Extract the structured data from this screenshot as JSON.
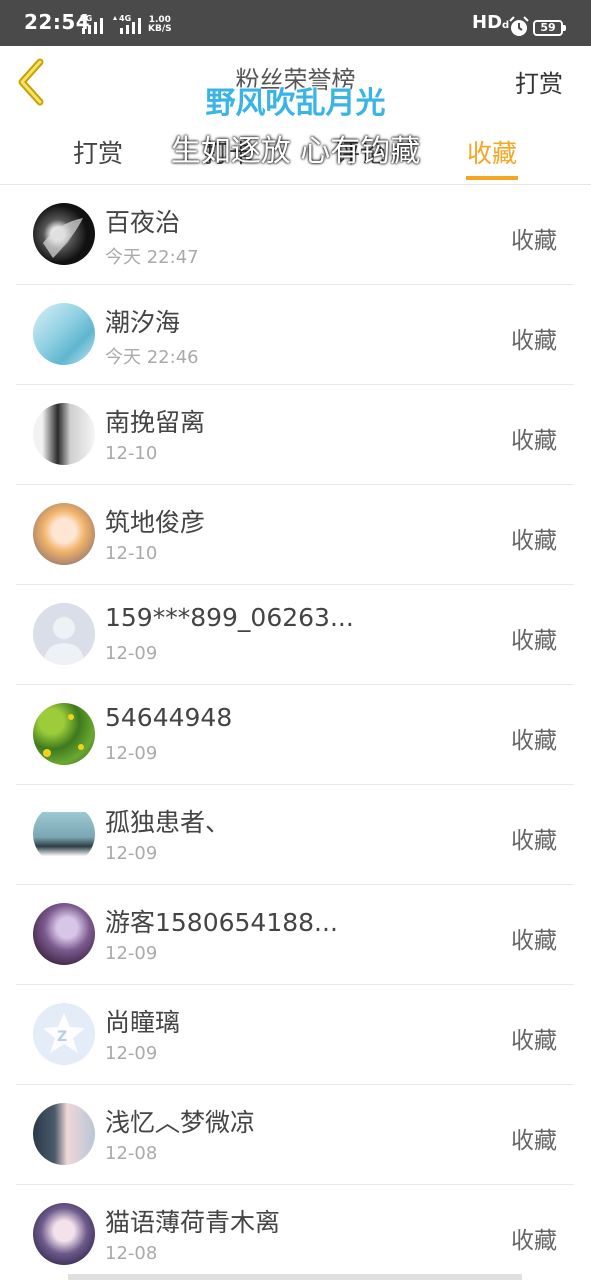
{
  "status_bar": {
    "time": "22:54",
    "net_2g": "2G",
    "net_4g": "4G",
    "speed_value": "1.00",
    "speed_unit": "KB/S",
    "hd": "HD",
    "battery": "59"
  },
  "header": {
    "title": "粉丝荣誉榜",
    "right_label": "打赏"
  },
  "overlay": {
    "line1": "野风吹乱月光",
    "line2": "生如逐放 心有钩藏"
  },
  "tabs": [
    {
      "label": "打赏",
      "active": false
    },
    {
      "label": "打卡",
      "active": false
    },
    {
      "label": "评论",
      "active": false
    },
    {
      "label": "收藏",
      "active": true
    }
  ],
  "list": [
    {
      "name": "百夜治",
      "time": "今天 22:47",
      "action": "收藏"
    },
    {
      "name": "潮汐海",
      "time": "今天 22:46",
      "action": "收藏"
    },
    {
      "name": "南挽留离",
      "time": "12-10",
      "action": "收藏"
    },
    {
      "name": "筑地俊彦",
      "time": "12-10",
      "action": "收藏"
    },
    {
      "name": "159***899_06263...",
      "time": "12-09",
      "action": "收藏"
    },
    {
      "name": "54644948",
      "time": "12-09",
      "action": "收藏"
    },
    {
      "name": "孤独患者、",
      "time": "12-09",
      "action": "收藏"
    },
    {
      "name": "游客1580654188...",
      "time": "12-09",
      "action": "收藏"
    },
    {
      "name": "尚瞳璃",
      "time": "12-09",
      "action": "收藏"
    },
    {
      "name": "浅忆︿梦微凉",
      "time": "12-08",
      "action": "收藏"
    },
    {
      "name": "猫语薄荷青木离",
      "time": "12-08",
      "action": "收藏"
    }
  ],
  "colors": {
    "accent": "#f5a623",
    "status_bar": "#4a4a4a",
    "overlay_blue": "#39b4e6"
  }
}
